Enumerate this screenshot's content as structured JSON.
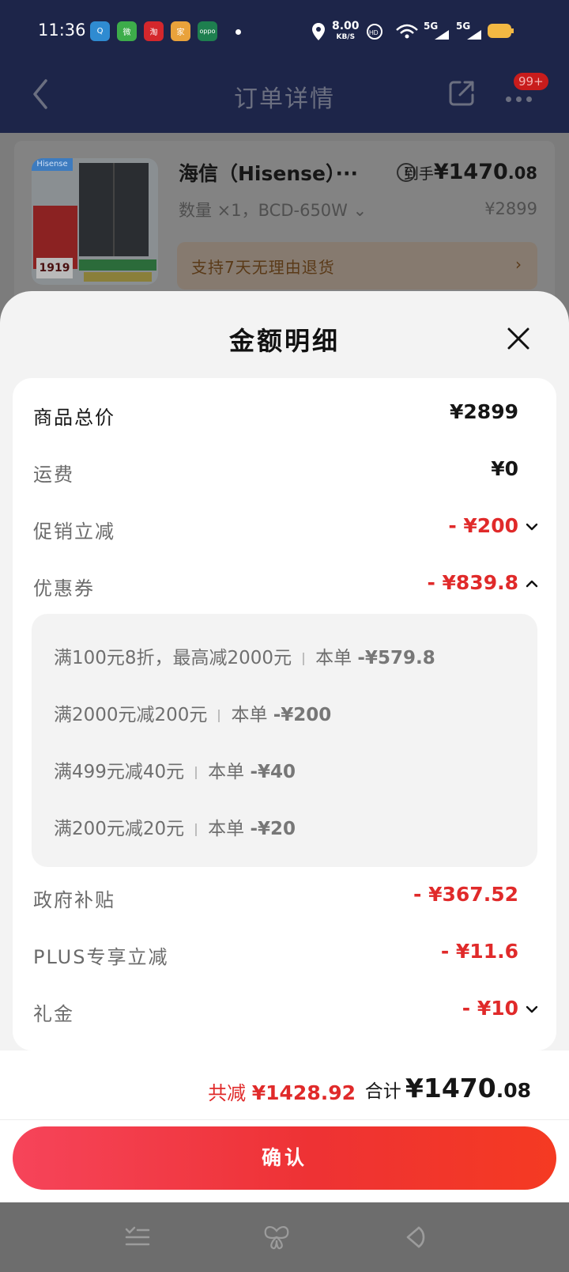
{
  "status_bar": {
    "time": "11:36",
    "net_speed": "8.00",
    "net_unit": "KB/S",
    "signal_1": "5G",
    "signal_2": "5G",
    "apps": [
      {
        "name": "Q",
        "color": "#2f8bd1"
      },
      {
        "name": "微",
        "color": "#3dac4a"
      },
      {
        "name": "淘",
        "color": "#d4272c"
      },
      {
        "name": "家",
        "color": "#e9a23b"
      },
      {
        "name": "oppo",
        "color": "#1e7f4f"
      }
    ]
  },
  "nav": {
    "title": "订单详情",
    "badge": "99+"
  },
  "product": {
    "name": "海信（Hisense）···",
    "spec": "数量 ×1，BCD-650W ⌄",
    "final_label": "到手",
    "final_int": "¥1470",
    "final_dec": ".08",
    "original_price": "¥2899",
    "return_policy": "支持7天无理由退货",
    "img_logo": "Hisense",
    "img_price": "1919"
  },
  "sheet": {
    "title": "金额明细",
    "rows": [
      {
        "label": "商品总价",
        "value": "¥2899"
      },
      {
        "label": "运费",
        "value": "¥0"
      },
      {
        "label": "促销立减",
        "value": "- ¥200"
      },
      {
        "label": "优惠券",
        "value": "- ¥839.8"
      },
      {
        "label": "政府补贴",
        "value": "- ¥367.52"
      },
      {
        "label": "PLUS专享立减",
        "value": "- ¥11.6"
      },
      {
        "label": "礼金",
        "value": "- ¥10"
      }
    ],
    "coupons": [
      {
        "desc": "满100元8折，最高减2000元",
        "tag": "本单",
        "amount": "-¥579.8"
      },
      {
        "desc": "满2000元减200元",
        "tag": "本单",
        "amount": "-¥200"
      },
      {
        "desc": "满499元减40元",
        "tag": "本单",
        "amount": "-¥40"
      },
      {
        "desc": "满200元减20元",
        "tag": "本单",
        "amount": "-¥20"
      }
    ]
  },
  "footer": {
    "saved_label": "共减",
    "saved_value": "¥1428.92",
    "total_label": "合计",
    "total_int": "¥1470",
    "total_dec": ".08",
    "confirm": "确认"
  },
  "colors": {
    "accent_red": "#e02a2a",
    "nav_bg": "#1d2549"
  }
}
